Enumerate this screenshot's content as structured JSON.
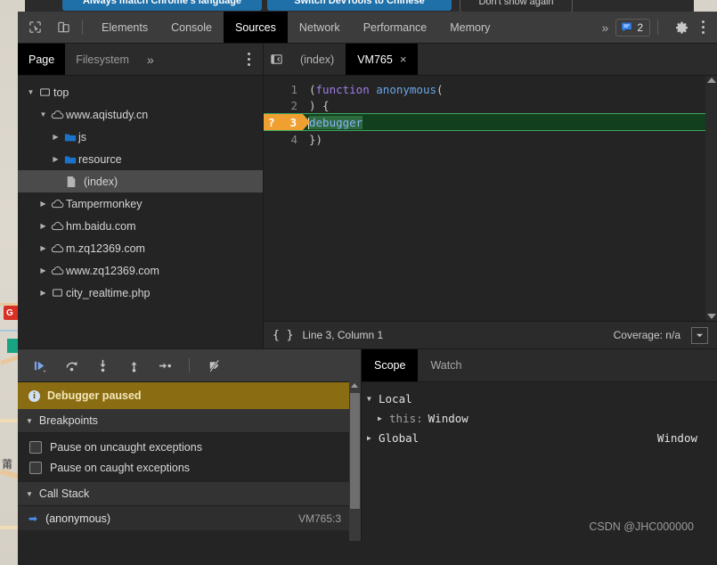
{
  "banner": {
    "buttons": [
      {
        "label": "Always match Chrome's language",
        "style": "primary"
      },
      {
        "label": "Switch DevTools to Chinese",
        "style": "primary"
      },
      {
        "label": "Don't show again",
        "style": "ghost"
      }
    ]
  },
  "toolbar": {
    "inspect_icon": "inspect-cursor-icon",
    "device_icon": "device-toolbar-icon",
    "tabs": [
      {
        "label": "Elements",
        "active": false
      },
      {
        "label": "Console",
        "active": false
      },
      {
        "label": "Sources",
        "active": true
      },
      {
        "label": "Network",
        "active": false
      },
      {
        "label": "Performance",
        "active": false
      },
      {
        "label": "Memory",
        "active": false
      }
    ],
    "more_tabs": "»",
    "message_count": "2",
    "message_icon": "message-bubble-icon",
    "settings_icon": "gear-icon",
    "menu_icon": "kebab-menu-icon"
  },
  "navigator": {
    "tabs": [
      {
        "label": "Page",
        "active": true
      },
      {
        "label": "Filesystem",
        "active": false
      }
    ],
    "more": "»",
    "menu_icon": "kebab-menu-icon",
    "tree": [
      {
        "label": "top",
        "icon": "frame-icon",
        "indent": 0,
        "expanded": true,
        "selected": false
      },
      {
        "label": "www.aqistudy.cn",
        "icon": "cloud-icon",
        "indent": 1,
        "expanded": true,
        "selected": false
      },
      {
        "label": "js",
        "icon": "folder-icon",
        "indent": 2,
        "expanded": false,
        "selected": false
      },
      {
        "label": "resource",
        "icon": "folder-icon",
        "indent": 2,
        "expanded": false,
        "selected": false
      },
      {
        "label": "(index)",
        "icon": "document-icon",
        "indent": 3,
        "expanded": null,
        "selected": true
      },
      {
        "label": "Tampermonkey",
        "icon": "cloud-icon",
        "indent": 1,
        "expanded": false,
        "selected": false
      },
      {
        "label": "hm.baidu.com",
        "icon": "cloud-icon",
        "indent": 1,
        "expanded": false,
        "selected": false
      },
      {
        "label": "m.zq12369.com",
        "icon": "cloud-icon",
        "indent": 1,
        "expanded": false,
        "selected": false
      },
      {
        "label": "www.zq12369.com",
        "icon": "cloud-icon",
        "indent": 1,
        "expanded": false,
        "selected": false
      },
      {
        "label": "city_realtime.php",
        "icon": "frame-icon",
        "indent": 1,
        "expanded": false,
        "selected": false
      }
    ]
  },
  "editor": {
    "panel_toggle_icon": "show-navigator-icon",
    "tabs": [
      {
        "label": "(index)",
        "active": false,
        "closeable": false
      },
      {
        "label": "VM765",
        "active": true,
        "closeable": true,
        "close_label": "×"
      }
    ],
    "lines": [
      {
        "num": "1",
        "text": "(function anonymous("
      },
      {
        "num": "2",
        "text": ") {"
      },
      {
        "num": "3",
        "text": "debugger"
      },
      {
        "num": "4",
        "text": "})"
      }
    ],
    "breakpoint_line": "3",
    "breakpoint_glyph": "?",
    "status": {
      "format_icon": "pretty-print-braces-icon",
      "position": "Line 3, Column 1",
      "coverage": "Coverage: n/a",
      "coverage_toggle_icon": "drawer-toggle-icon"
    }
  },
  "debugger": {
    "controls": [
      {
        "name": "resume-script-execution",
        "icon": "resume-icon"
      },
      {
        "name": "step-over-next-function-call",
        "icon": "step-over-icon"
      },
      {
        "name": "step-into-next-function-call",
        "icon": "step-into-icon"
      },
      {
        "name": "step-out-of-current-function",
        "icon": "step-out-icon"
      },
      {
        "name": "step",
        "icon": "step-icon"
      },
      {
        "name": "deactivate-breakpoints",
        "icon": "deactivate-breakpoints-icon"
      }
    ],
    "paused_icon": "info-icon",
    "paused_message": "Debugger paused",
    "sections": [
      {
        "title": "Breakpoints",
        "expanded": true,
        "options": [
          {
            "label": "Pause on uncaught exceptions",
            "checked": false
          },
          {
            "label": "Pause on caught exceptions",
            "checked": false
          }
        ]
      },
      {
        "title": "Call Stack",
        "expanded": true
      }
    ],
    "call_stack": [
      {
        "name": "(anonymous)",
        "location": "VM765:3",
        "active": true
      }
    ]
  },
  "scope": {
    "tabs": [
      {
        "label": "Scope",
        "active": true
      },
      {
        "label": "Watch",
        "active": false
      }
    ],
    "entries": [
      {
        "caret": "▼",
        "name": "Local",
        "value": "",
        "right": "",
        "indent": 0
      },
      {
        "caret": "▶",
        "name": "this:",
        "value": "Window",
        "right": "",
        "indent": 1
      },
      {
        "caret": "▶",
        "name": "Global",
        "value": "",
        "right": "Window",
        "indent": 0
      }
    ]
  },
  "watermark": "CSDN @JHC000000",
  "colors": {
    "accent_blue": "#4a8ff0",
    "paused_amber": "#8a6d12",
    "breakpoint_orange": "#f0a030",
    "highlight_green": "#12401e",
    "panel_bg": "#242424",
    "toolbar_bg": "#3c3c3c"
  }
}
